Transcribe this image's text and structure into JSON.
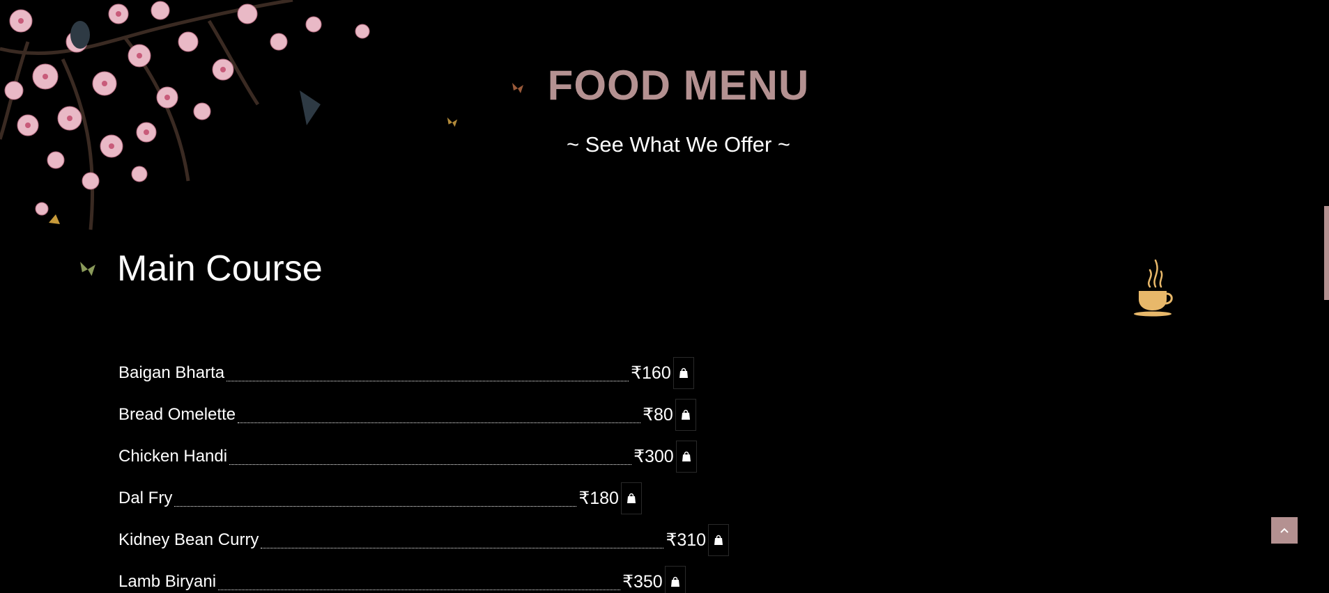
{
  "header": {
    "title": "FOOD MENU",
    "subtitle": "~ See What We Offer ~"
  },
  "section": {
    "heading": "Main Course"
  },
  "items": [
    {
      "name": "Baigan Bharta",
      "price": "₹160"
    },
    {
      "name": "Bread Omelette",
      "price": "₹80"
    },
    {
      "name": "Chicken Handi",
      "price": "₹300"
    },
    {
      "name": "Dal Fry",
      "price": "₹180"
    },
    {
      "name": "Kidney Bean Curry",
      "price": "₹310"
    },
    {
      "name": "Lamb Biryani",
      "price": "₹350"
    }
  ],
  "icons": {
    "cart": "shopping-bag-icon",
    "cup": "coffee-cup-icon",
    "scroll_top": "chevron-up-icon"
  },
  "colors": {
    "background": "#000000",
    "accent": "#b49191",
    "text": "#ffffff",
    "cup": "#e8b86a"
  }
}
